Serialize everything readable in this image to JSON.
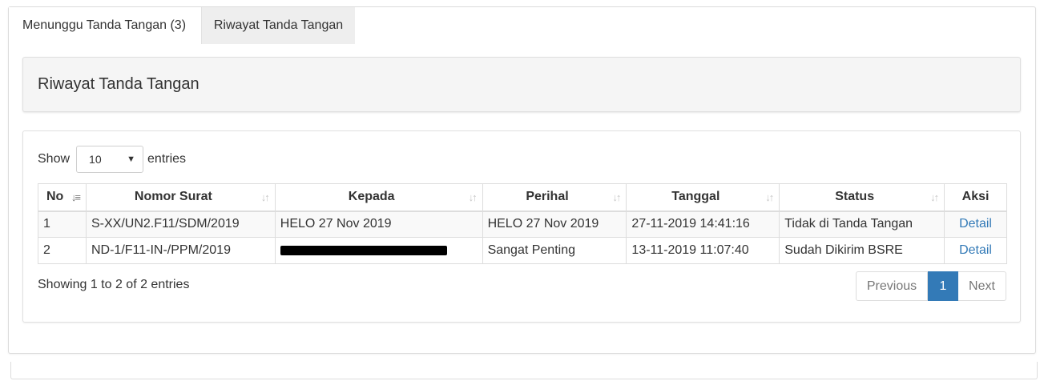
{
  "tabs": [
    {
      "label": "Menunggu Tanda Tangan (3)"
    },
    {
      "label": "Riwayat Tanda Tangan"
    }
  ],
  "panel": {
    "title": "Riwayat Tanda Tangan"
  },
  "length": {
    "show": "Show",
    "value": "10",
    "entries": "entries"
  },
  "table": {
    "headers": [
      "No",
      "Nomor Surat",
      "Kepada",
      "Perihal",
      "Tanggal",
      "Status",
      "Aksi"
    ],
    "rows": [
      {
        "no": "1",
        "nomor": "S-XX/UN2.F11/SDM/2019",
        "kepada": "HELO 27 Nov 2019",
        "perihal": "HELO 27 Nov 2019",
        "tanggal": "27-11-2019 14:41:16",
        "status": "Tidak di Tanda Tangan",
        "aksi": "Detail"
      },
      {
        "no": "2",
        "nomor": "ND-1/F11-IN-/PPM/2019",
        "kepada": "",
        "perihal": "Sangat Penting",
        "tanggal": "13-11-2019 11:07:40",
        "status": "Sudah Dikirim BSRE",
        "aksi": "Detail"
      }
    ]
  },
  "info": "Showing 1 to 2 of 2 entries",
  "pagination": {
    "previous": "Previous",
    "current": "1",
    "next": "Next"
  },
  "colors": {
    "link": "#337ab7",
    "active_page": "#337ab7",
    "tab_inactive_bg": "#eeeeee",
    "panel_head_bg": "#f5f5f5"
  },
  "icons": {
    "sort": "sort-icon",
    "sort_active": "sort-asc-icon",
    "select_arrow": "caret-down-icon"
  }
}
